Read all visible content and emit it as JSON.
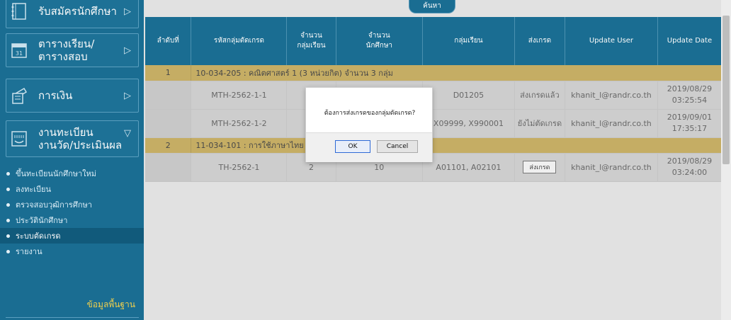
{
  "sidebar": {
    "menu": [
      {
        "label": "รับสมัครนักศึกษา",
        "icon": "notebook-icon",
        "chevron": "▷"
      },
      {
        "label_line1": "ตารางเรียน/",
        "label_line2": "ตารางสอบ",
        "icon": "calendar-icon",
        "chevron": "▷"
      },
      {
        "label": "การเงิน",
        "icon": "finance-icon",
        "chevron": "▷"
      },
      {
        "label_line1": "งานทะเบียน",
        "label_line2": "งานวัด/ประเมินผล",
        "icon": "registration-icon",
        "chevron": "▽"
      }
    ],
    "sub_items": [
      "ขึ้นทะเบียนนักศึกษาใหม่",
      "ลงทะเบียน",
      "ตรวจสอบวุฒิการศึกษา",
      "ประวัตินักศึกษา",
      "ระบบตัดเกรด",
      "รายงาน"
    ],
    "active_index": 4,
    "footer_label": "ข้อมูลพื้นฐาน"
  },
  "search_button": "ค้นหา",
  "table": {
    "headers": {
      "index": "ลำดับที่",
      "group_code": "รหัสกลุ่มตัดเกรด",
      "num_groups_1": "จำนวน",
      "num_groups_2": "กลุ่มเรียน",
      "num_students_1": "จำนวน",
      "num_students_2": "นักศึกษา",
      "groups": "กลุ่มเรียน",
      "send_grade": "ส่งเกรด",
      "update_user": "Update User",
      "update_date": "Update Date"
    },
    "groups": [
      {
        "num": "1",
        "title": "10-034-205 : คณิตศาสตร์ 1 (3 หน่วยกิต) จำนวน 3 กลุ่ม",
        "rows": [
          {
            "code": "MTH-2562-1-1",
            "num_groups": "",
            "num_students": "",
            "groups": "D01205",
            "status": "ส่งเกรดแล้ว",
            "user": "khanit_l@randr.co.th",
            "date": "2019/08/29",
            "time": "03:25:54"
          },
          {
            "code": "MTH-2562-1-2",
            "num_groups": "",
            "num_students": "",
            "groups": "X09999, X990001",
            "status": "ยังไม่ตัดเกรด",
            "user": "khanit_l@randr.co.th",
            "date": "2019/09/01",
            "time": "17:35:17"
          }
        ]
      },
      {
        "num": "2",
        "title": "11-034-101 : การใช้ภาษาไทย (3 หน่วยกิต) จำนวน 2 กลุ่ม",
        "rows": [
          {
            "code": "TH-2562-1",
            "num_groups": "2",
            "num_students": "10",
            "groups": "A01101, A02101",
            "status_button": "ส่งเกรด",
            "user": "khanit_l@randr.co.th",
            "date": "2019/08/29",
            "time": "03:24:00"
          }
        ]
      }
    ]
  },
  "dialog": {
    "message": "ต้องการส่งเกรดของกลุ่มตัดเกรด?",
    "ok_label": "OK",
    "cancel_label": "Cancel"
  },
  "window_close_glyph": "×"
}
